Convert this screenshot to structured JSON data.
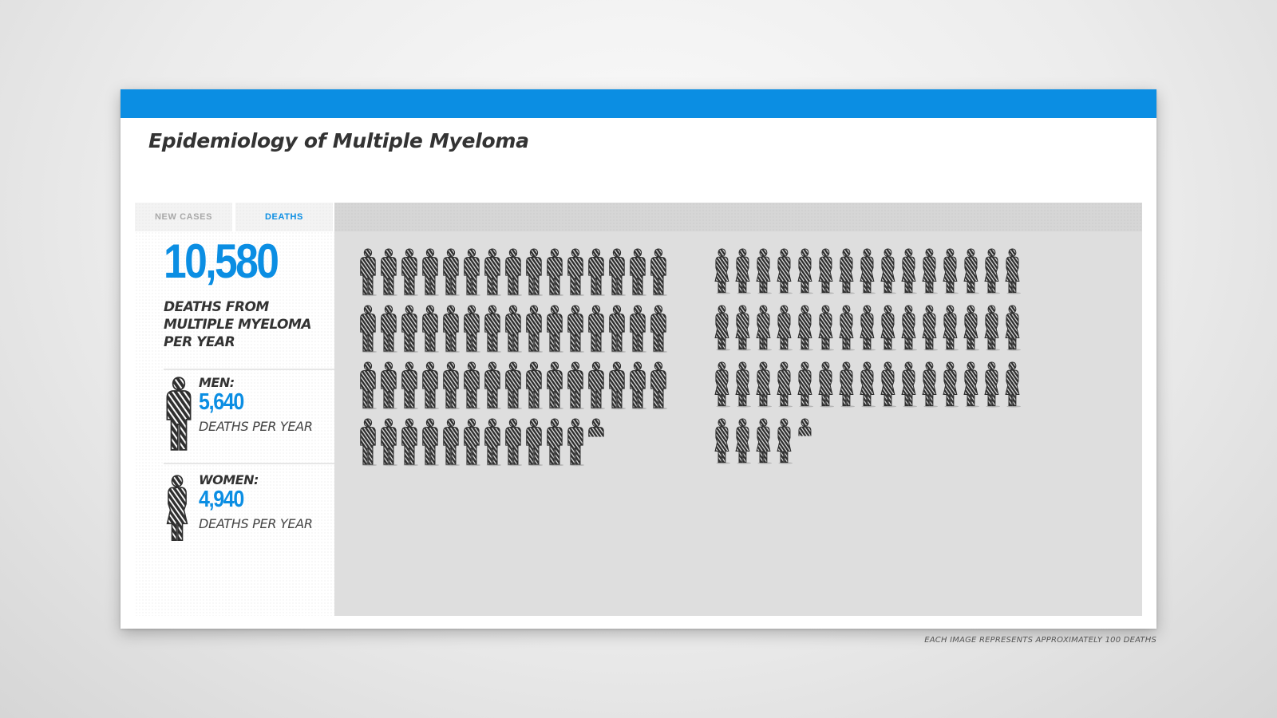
{
  "colors": {
    "accent": "#0b8ee3",
    "figure": "#2f2f2f",
    "title": "#333333"
  },
  "header": {
    "title": "Epidemiology of Multiple Myeloma"
  },
  "tabs": [
    {
      "label": "NEW CASES",
      "active": false
    },
    {
      "label": "DEATHS",
      "active": true
    }
  ],
  "summary": {
    "total": "10,580",
    "total_label": "DEATHS FROM MULTIPLE MYELOMA PER YEAR",
    "men": {
      "label": "MEN:",
      "value": "5,640",
      "unit": "DEATHS PER YEAR",
      "icon": "man-figure-icon"
    },
    "women": {
      "label": "WOMEN:",
      "value": "4,940",
      "unit": "DEATHS PER YEAR",
      "icon": "woman-figure-icon"
    }
  },
  "footnote": "EACH IMAGE REPRESENTS APPROXIMATELY 100 DEATHS",
  "chart_data": {
    "type": "pictogram",
    "unit_value": 100,
    "per_row": 15,
    "series": [
      {
        "name": "MEN:",
        "value": 5640,
        "icon": "man-figure-icon"
      },
      {
        "name": "WOMEN:",
        "value": 4940,
        "icon": "woman-figure-icon"
      }
    ]
  }
}
